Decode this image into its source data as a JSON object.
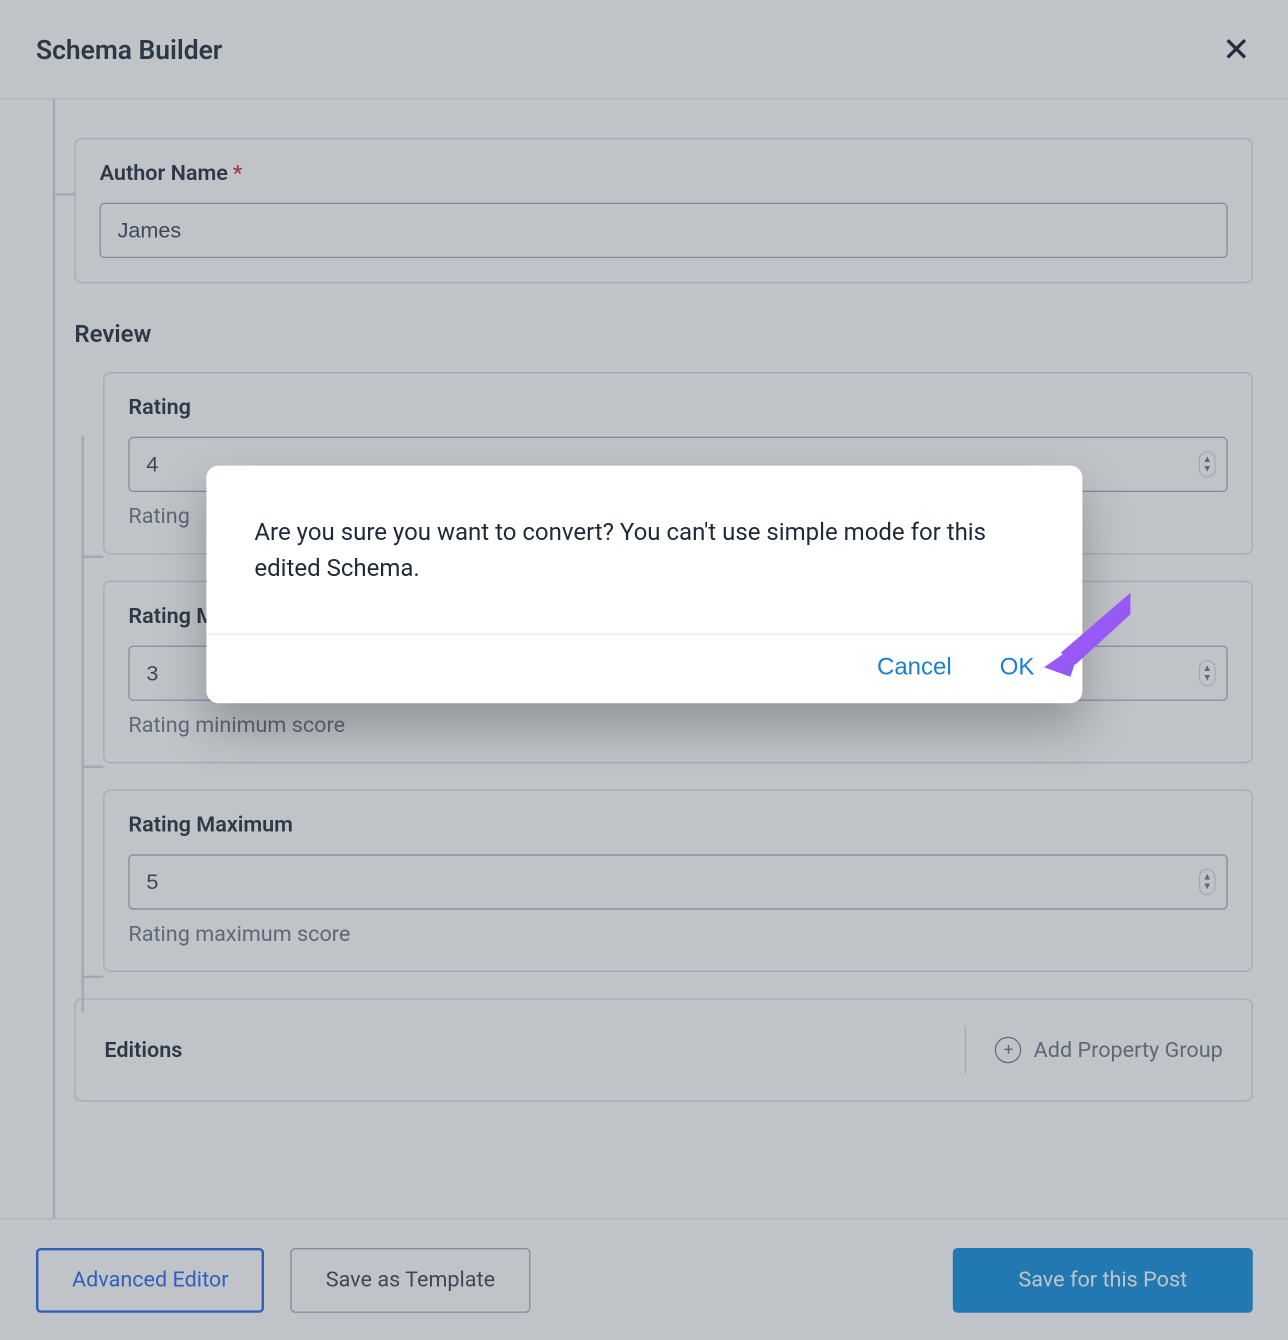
{
  "header": {
    "title": "Schema Builder"
  },
  "author": {
    "label": "Author Name",
    "value": "James"
  },
  "review": {
    "section": "Review",
    "rating": {
      "label": "Rating",
      "value": "4",
      "help": "Rating"
    },
    "ratingMin": {
      "label": "Rating Minimum",
      "value": "3",
      "help": "Rating minimum score"
    },
    "ratingMax": {
      "label": "Rating Maximum",
      "value": "5",
      "help": "Rating maximum score"
    }
  },
  "editions": {
    "label": "Editions",
    "add": "Add Property Group"
  },
  "footer": {
    "advanced": "Advanced Editor",
    "template": "Save as Template",
    "save": "Save for this Post"
  },
  "modal": {
    "message": "Are you sure you want to convert? You can't use simple mode for this edited Schema.",
    "cancel": "Cancel",
    "ok": "OK"
  }
}
